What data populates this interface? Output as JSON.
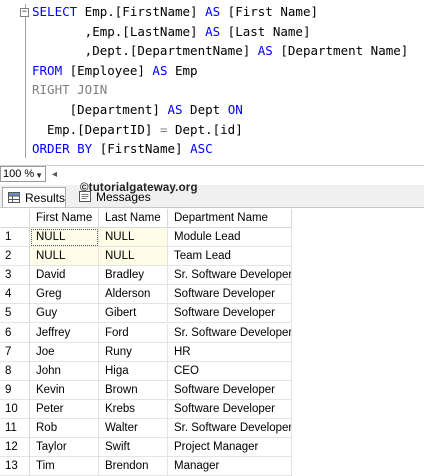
{
  "editor": {
    "collapse_glyph": "−",
    "lines": [
      [
        {
          "t": "SELECT",
          "c": "kw"
        },
        {
          "t": " Emp.[FirstName] ",
          "c": ""
        },
        {
          "t": "AS",
          "c": "kw"
        },
        {
          "t": " [First Name]",
          "c": ""
        }
      ],
      [
        {
          "t": "       ,Emp.[LastName] ",
          "c": ""
        },
        {
          "t": "AS",
          "c": "kw"
        },
        {
          "t": " [Last Name]",
          "c": ""
        }
      ],
      [
        {
          "t": "       ,Dept.[DepartmentName] ",
          "c": ""
        },
        {
          "t": "AS",
          "c": "kw"
        },
        {
          "t": " [Department Name]",
          "c": ""
        }
      ],
      [
        {
          "t": "FROM",
          "c": "kw"
        },
        {
          "t": " [Employee] ",
          "c": ""
        },
        {
          "t": "AS",
          "c": "kw"
        },
        {
          "t": " Emp",
          "c": ""
        }
      ],
      [
        {
          "t": "RIGHT JOIN",
          "c": "gray"
        }
      ],
      [
        {
          "t": "     [Department] ",
          "c": ""
        },
        {
          "t": "AS",
          "c": "kw"
        },
        {
          "t": " Dept ",
          "c": ""
        },
        {
          "t": "ON",
          "c": "kw"
        }
      ],
      [
        {
          "t": "  Emp.[DepartID] ",
          "c": ""
        },
        {
          "t": "=",
          "c": "gray"
        },
        {
          "t": " Dept.[id]",
          "c": ""
        }
      ],
      [
        {
          "t": "ORDER BY",
          "c": "kw"
        },
        {
          "t": " [FirstName] ",
          "c": ""
        },
        {
          "t": "ASC",
          "c": "kw"
        }
      ]
    ]
  },
  "zoom": {
    "value": "100 %"
  },
  "tabs": {
    "results": "Results",
    "messages": "Messages"
  },
  "watermark": "©tutorialgateway.org",
  "grid": {
    "columns": [
      "First Name",
      "Last Name",
      "Department Name"
    ],
    "rows": [
      [
        "1",
        "NULL",
        "NULL",
        "Module Lead"
      ],
      [
        "2",
        "NULL",
        "NULL",
        "Team Lead"
      ],
      [
        "3",
        "David",
        "Bradley",
        "Sr. Software Developer"
      ],
      [
        "4",
        "Greg",
        "Alderson",
        "Software Developer"
      ],
      [
        "5",
        "Guy",
        "Gibert",
        "Software Developer"
      ],
      [
        "6",
        "Jeffrey",
        "Ford",
        "Sr. Software Developer"
      ],
      [
        "7",
        "Joe",
        "Runy",
        "HR"
      ],
      [
        "8",
        "John",
        "Higa",
        "CEO"
      ],
      [
        "9",
        "Kevin",
        "Brown",
        "Software Developer"
      ],
      [
        "10",
        "Peter",
        "Krebs",
        "Software Developer"
      ],
      [
        "11",
        "Rob",
        "Walter",
        "Sr. Software Developer"
      ],
      [
        "12",
        "Taylor",
        "Swift",
        "Project Manager"
      ],
      [
        "13",
        "Tim",
        "Brendon",
        "Manager"
      ]
    ]
  }
}
